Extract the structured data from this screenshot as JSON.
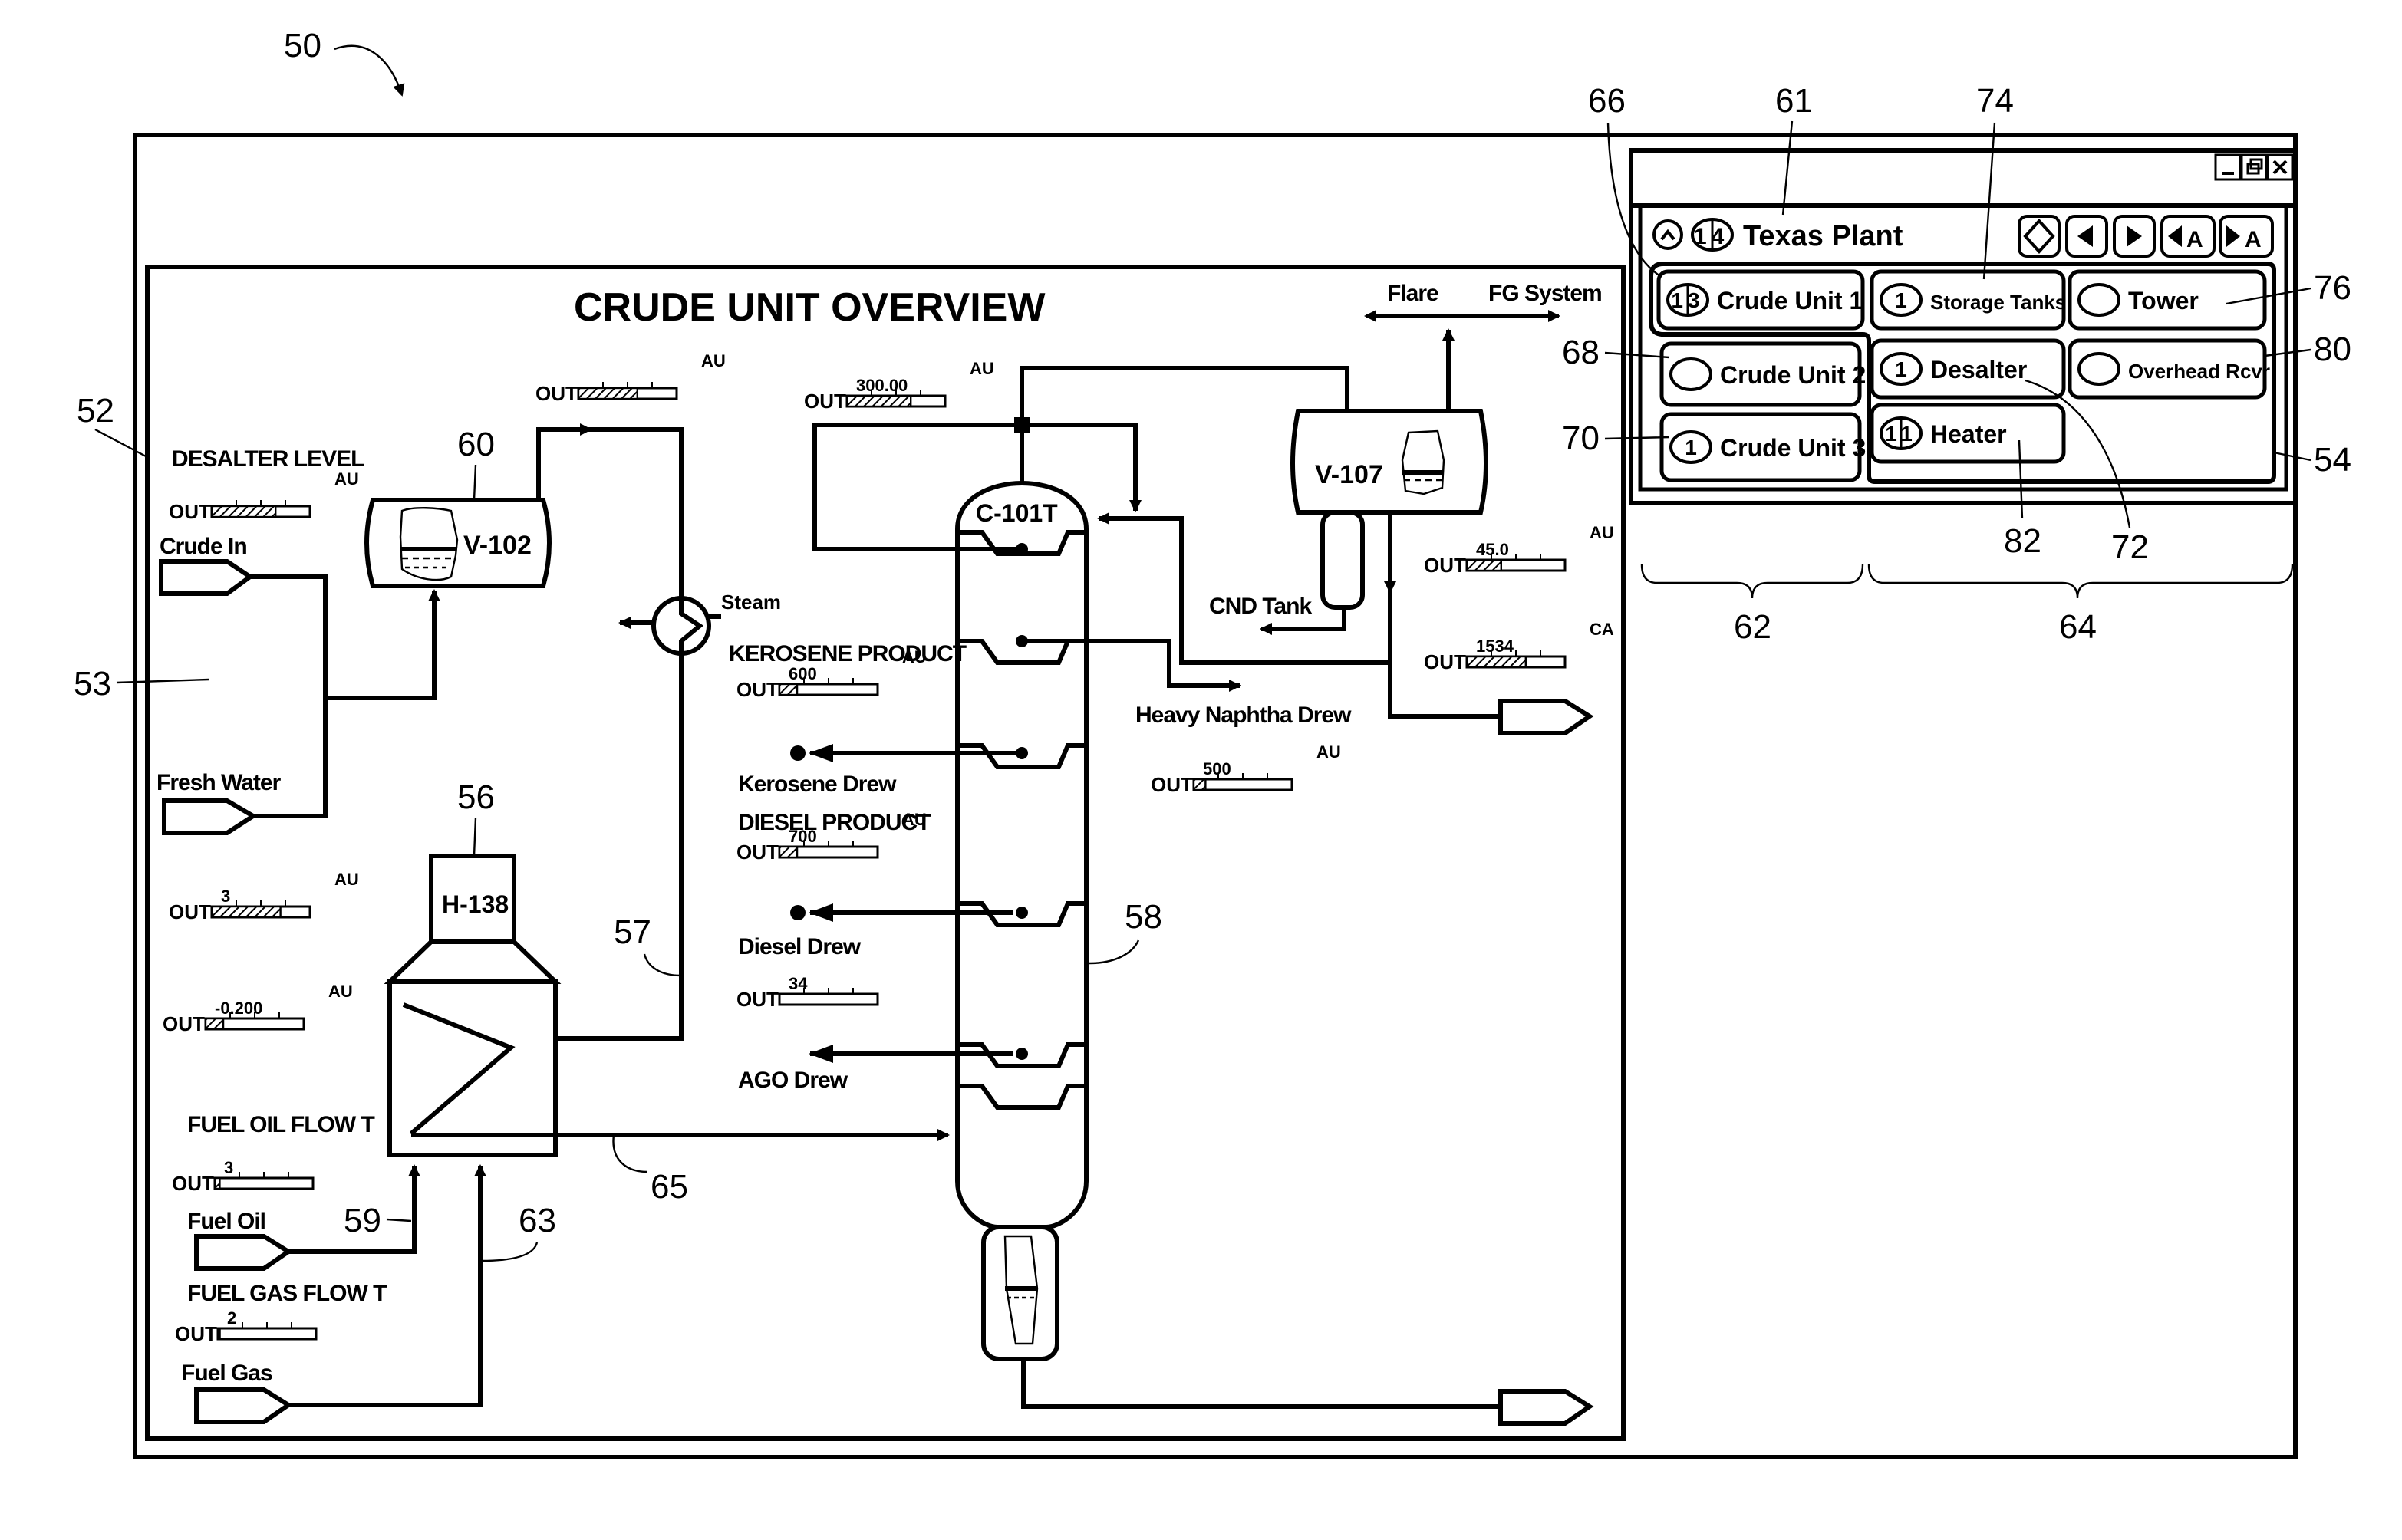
{
  "figure": {
    "ref_numerals": {
      "figure": "50",
      "screen": "52",
      "graphic": "53",
      "nav_panel": "54",
      "heater": "56",
      "line57": "57",
      "column": "58",
      "line59": "59",
      "vessel": "60",
      "plant_title": "61",
      "left_group": "62",
      "line63": "63",
      "right_group": "64",
      "line65": "65",
      "crude_unit_1": "66",
      "crude_unit_2": "68",
      "crude_unit_3": "70",
      "desalter": "72",
      "storage_tanks": "74",
      "tower": "76",
      "overhead_rcvr": "80",
      "heater_btn": "82"
    }
  },
  "overview": {
    "title": "CRUDE UNIT OVERVIEW",
    "labels": {
      "desalter_level": "DESALTER LEVEL",
      "crude_in": "Crude In",
      "fresh_water": "Fresh Water",
      "steam": "Steam",
      "kerosene_product": "KEROSENE PRODUCT",
      "kerosene_drew": "Kerosene Drew",
      "diesel_product": "DIESEL PRODUCT",
      "diesel_drew": "Diesel Drew",
      "ago_drew": "AGO Drew",
      "heavy_naphtha_drew": "Heavy Naphtha Drew",
      "cnd_tank": "CND Tank",
      "flare": "Flare",
      "fg_system": "FG System",
      "fuel_oil_flow": "FUEL OIL FLOW T",
      "fuel_oil": "Fuel Oil",
      "fuel_gas_flow": "FUEL GAS FLOW T",
      "fuel_gas": "Fuel Gas"
    },
    "equipment": {
      "v102": "V-102",
      "v107": "V-107",
      "c101t": "C-101T",
      "h138": "H-138"
    },
    "gauges": [
      {
        "id": "desalter-level",
        "prefix": "OUT",
        "value": "",
        "unit": "AU",
        "fill": 0.65
      },
      {
        "id": "v102-out",
        "prefix": "OUT",
        "value": "",
        "unit": "AU",
        "fill": 0.6
      },
      {
        "id": "reflux",
        "prefix": "OUT",
        "value": "300.00",
        "unit": "AU",
        "fill": 0.65
      },
      {
        "id": "heater-3",
        "prefix": "OUT",
        "value": "3",
        "unit": "AU",
        "fill": 0.7
      },
      {
        "id": "heater-neg",
        "prefix": "OUT",
        "value": "-0.200",
        "unit": "AU",
        "fill": 0.18
      },
      {
        "id": "fuel-oil",
        "prefix": "OUT",
        "value": "3",
        "unit": "",
        "fill": 0.05
      },
      {
        "id": "fuel-gas",
        "prefix": "OUT",
        "value": "2",
        "unit": "",
        "fill": 0.02
      },
      {
        "id": "kerosene",
        "prefix": "OUT",
        "value": "600",
        "unit": "AU",
        "fill": 0.18
      },
      {
        "id": "diesel",
        "prefix": "OUT",
        "value": "700",
        "unit": "AU",
        "fill": 0.18
      },
      {
        "id": "ago",
        "prefix": "OUT",
        "value": "34",
        "unit": "",
        "fill": 0.0
      },
      {
        "id": "naphtha",
        "prefix": "OUT",
        "value": "500",
        "unit": "AU",
        "fill": 0.12
      },
      {
        "id": "v107-level",
        "prefix": "OUT",
        "value": "45.0",
        "unit": "AU",
        "fill": 0.35
      },
      {
        "id": "overhead-flow",
        "prefix": "OUT",
        "value": "1534",
        "unit": "CA",
        "fill": 0.6
      }
    ]
  },
  "nav_window": {
    "controls": {
      "minimize": "_",
      "restore": "❐",
      "close": "×"
    },
    "plant": {
      "name": "Texas Plant",
      "count": "14"
    },
    "toolbar": [
      "diamond-button",
      "prev-button",
      "next-button",
      "prev-alarm-button",
      "next-alarm-button"
    ],
    "toolbar_labels": {
      "prev_alarm": "A",
      "next_alarm": "A"
    },
    "buttons": {
      "crude_unit_1": {
        "label": "Crude Unit 1",
        "badge": "13"
      },
      "crude_unit_2": {
        "label": "Crude Unit 2",
        "badge": ""
      },
      "crude_unit_3": {
        "label": "Crude Unit 3",
        "badge": "1"
      },
      "storage_tanks": {
        "label": "Storage Tanks",
        "badge": "1"
      },
      "tower": {
        "label": "Tower",
        "badge": ""
      },
      "desalter": {
        "label": "Desalter",
        "badge": "1"
      },
      "overhead_rcvr": {
        "label": "Overhead Rcvr",
        "badge": ""
      },
      "heater": {
        "label": "Heater",
        "badge": "11"
      }
    }
  }
}
